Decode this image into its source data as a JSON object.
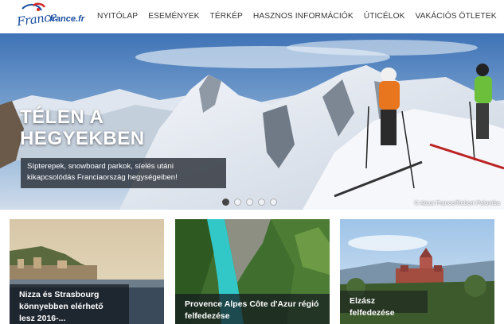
{
  "header": {
    "logo_script": "France",
    "logo_domain": "france.fr",
    "nav": [
      "NYITÓLAP",
      "ESEMÉNYEK",
      "TÉRKÉP",
      "HASZNOS INFORMÁCIÓK",
      "ÚTICÉLOK",
      "VAKÁCIÓS ÖTLETEK"
    ]
  },
  "hero": {
    "title": "TÉLEN A HEGYEKBEN",
    "caption": "Sípterepek, snowboard parkok, síelés utáni kikapcsolódás Franciaország hegységeiben!",
    "credit": "© Atout France/Robert Palomba",
    "slides": 5,
    "active_slide": 1
  },
  "cards": [
    {
      "label": "Nizza és Strasbourg könnyebben elérhető lesz 2016-..."
    },
    {
      "label": "Provence Alpes Côte d'Azur régió felfedezése"
    },
    {
      "label": "Elzász felfedezése"
    }
  ],
  "icons": {
    "logo_mark": "france-logo-icon"
  },
  "colors": {
    "brand_blue": "#1a4fa0",
    "accent_red": "#d62828",
    "nav_text": "#3a3a3a"
  }
}
